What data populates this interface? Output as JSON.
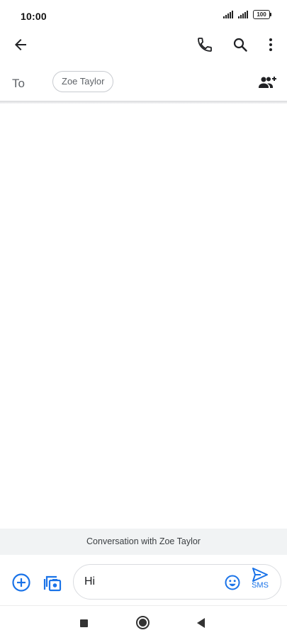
{
  "status_bar": {
    "time": "10:00",
    "battery_level": "100",
    "icons": [
      "signal-icon",
      "signal-icon",
      "battery-icon"
    ]
  },
  "toolbar": {
    "icons": [
      "back-arrow-icon",
      "phone-icon",
      "search-icon",
      "more-vert-icon"
    ]
  },
  "recipients": {
    "to_label": "To",
    "chips": [
      "Zoe Taylor"
    ],
    "add_people_icon": "group-add-icon"
  },
  "conversation": {
    "banner_text": "Conversation with Zoe Taylor"
  },
  "compose": {
    "message_value": "Hi",
    "send_label": "SMS",
    "icons": [
      "add-circle-icon",
      "photo-attach-icon",
      "emoji-icon",
      "send-icon"
    ]
  },
  "nav_bar": {
    "icons": [
      "recents-icon",
      "home-icon",
      "back-icon"
    ]
  },
  "colors": {
    "accent": "#1a73e8",
    "icon_dark": "#202124",
    "banner_background": "#f1f3f4",
    "secondary_text": "#5f6368"
  }
}
